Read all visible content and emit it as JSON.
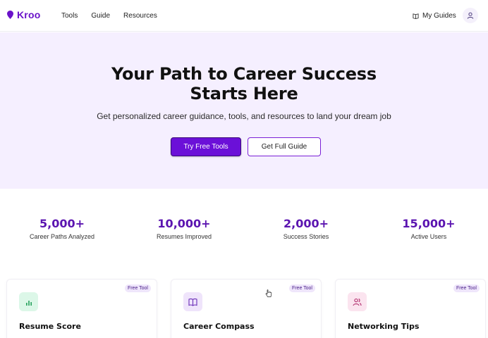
{
  "header": {
    "logo": "Kroo",
    "nav": [
      "Tools",
      "Guide",
      "Resources"
    ],
    "my_guides": "My Guides",
    "icons": {
      "logo": "pin-icon",
      "guides": "book-icon",
      "user": "user-icon"
    }
  },
  "hero": {
    "title_line1": "Your Path to Career Success",
    "title_line2": "Starts Here",
    "subtitle": "Get personalized career guidance, tools, and resources to land your dream job",
    "primary_button": "Try Free Tools",
    "secondary_button": "Get Full Guide"
  },
  "stats": [
    {
      "value": "5,000+",
      "label": "Career Paths Analyzed"
    },
    {
      "value": "10,000+",
      "label": "Resumes Improved"
    },
    {
      "value": "2,000+",
      "label": "Success Stories"
    },
    {
      "value": "15,000+",
      "label": "Active Users"
    }
  ],
  "cards": [
    {
      "title": "Resume Score",
      "badge": "Free Tool",
      "icon": "bar-chart-icon",
      "icon_bg": "#dcf7e8",
      "icon_color": "#26a15c"
    },
    {
      "title": "Career Compass",
      "badge": "Free Tool",
      "icon": "open-book-icon",
      "icon_bg": "#efe4fb",
      "icon_color": "#6b2fb8"
    },
    {
      "title": "Networking Tips",
      "badge": "Free Tool",
      "icon": "users-icon",
      "icon_bg": "#fbe4ef",
      "icon_color": "#b02a6a"
    }
  ],
  "colors": {
    "brand": "#6a12c9",
    "primary_button": "#6b10d8",
    "hero_background": "#f5efff",
    "stat_value": "#5b14b0"
  }
}
